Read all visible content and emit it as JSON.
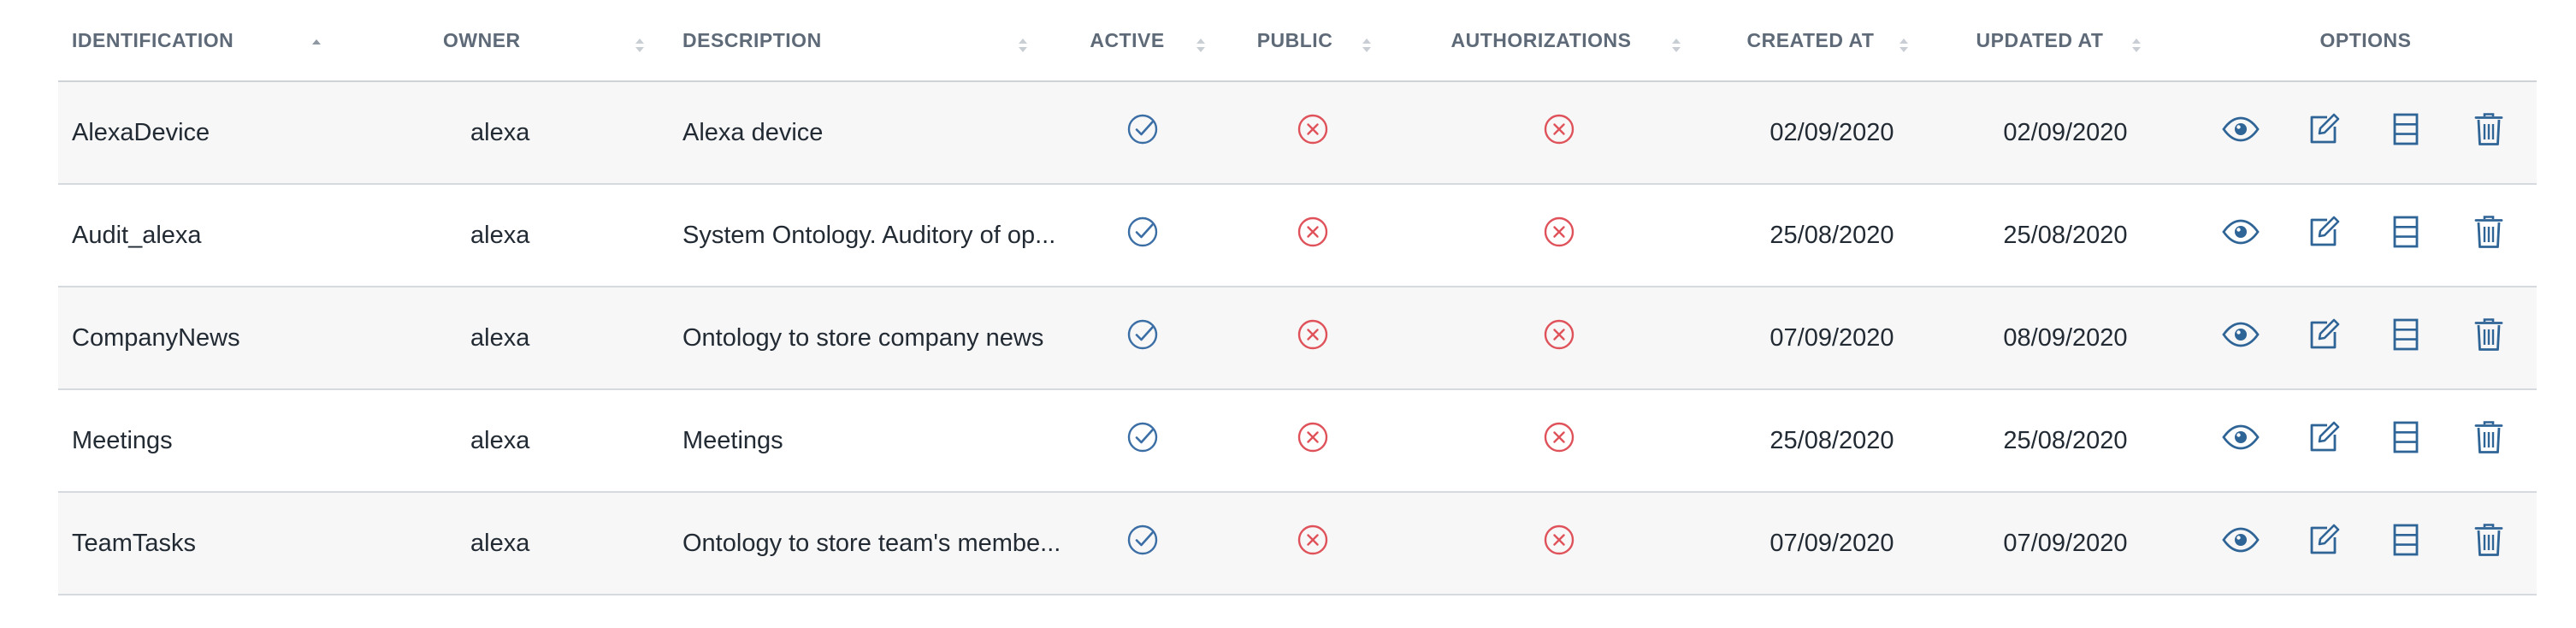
{
  "columns": {
    "identification": "IDENTIFICATION",
    "owner": "OWNER",
    "description": "DESCRIPTION",
    "active": "ACTIVE",
    "public": "PUBLIC",
    "authorizations": "AUTHORIZATIONS",
    "created_at": "CREATED AT",
    "updated_at": "UPDATED AT",
    "options": "OPTIONS"
  },
  "sort": {
    "column": "identification",
    "direction": "asc"
  },
  "rows": [
    {
      "identification": "AlexaDevice",
      "owner": "alexa",
      "description": "Alexa device",
      "active": true,
      "public": false,
      "authorizations": false,
      "created_at": "02/09/2020",
      "updated_at": "02/09/2020"
    },
    {
      "identification": "Audit_alexa",
      "owner": "alexa",
      "description": "System Ontology. Auditory of op...",
      "active": true,
      "public": false,
      "authorizations": false,
      "created_at": "25/08/2020",
      "updated_at": "25/08/2020"
    },
    {
      "identification": "CompanyNews",
      "owner": "alexa",
      "description": "Ontology to store company news",
      "active": true,
      "public": false,
      "authorizations": false,
      "created_at": "07/09/2020",
      "updated_at": "08/09/2020"
    },
    {
      "identification": "Meetings",
      "owner": "alexa",
      "description": "Meetings",
      "active": true,
      "public": false,
      "authorizations": false,
      "created_at": "25/08/2020",
      "updated_at": "25/08/2020"
    },
    {
      "identification": "TeamTasks",
      "owner": "alexa",
      "description": "Ontology to store team's membe...",
      "active": true,
      "public": false,
      "authorizations": false,
      "created_at": "07/09/2020",
      "updated_at": "07/09/2020"
    }
  ],
  "row_actions": [
    {
      "name": "view",
      "icon": "eye-icon"
    },
    {
      "name": "edit",
      "icon": "edit-icon"
    },
    {
      "name": "details",
      "icon": "list-icon"
    },
    {
      "name": "delete",
      "icon": "trash-icon"
    }
  ],
  "colors": {
    "check": "#3a6ea5",
    "cross": "#e0525a",
    "action": "#2f6496",
    "header_text": "#5e6a78"
  }
}
